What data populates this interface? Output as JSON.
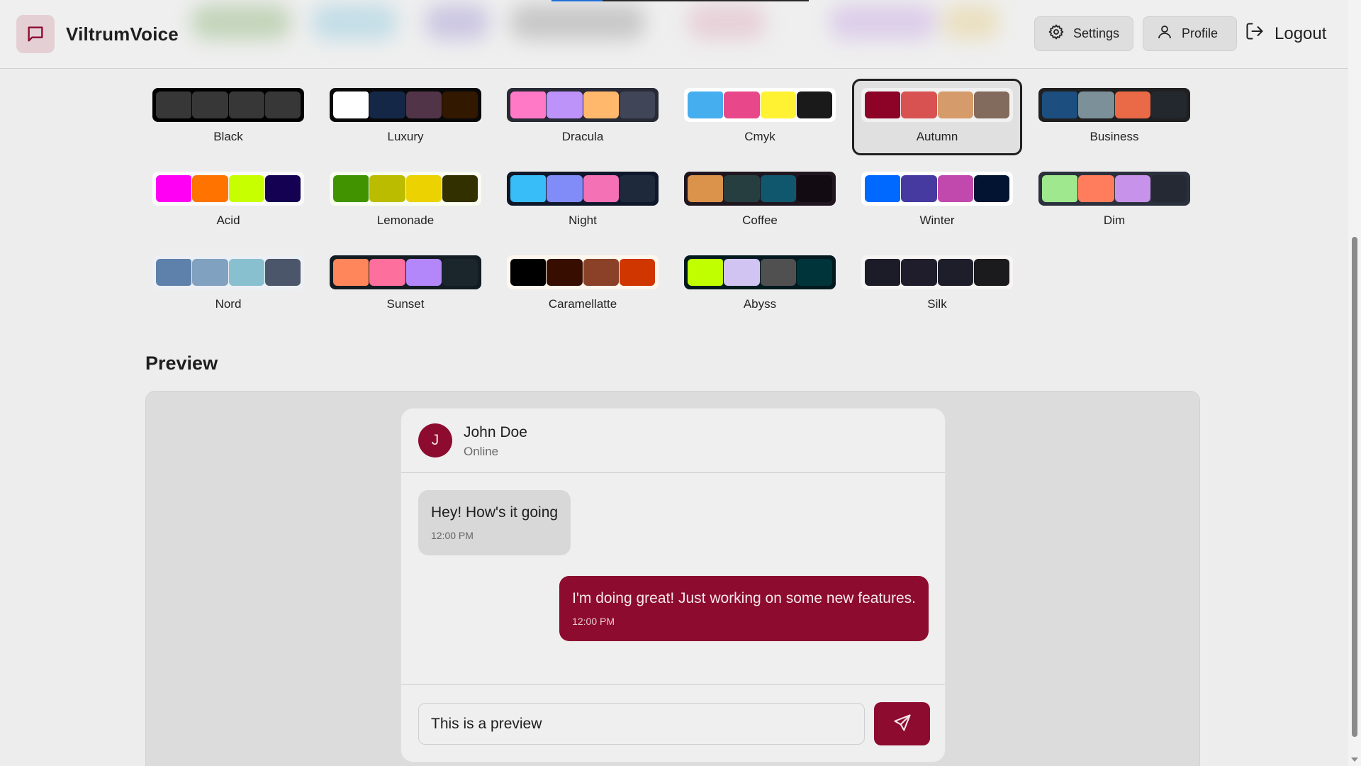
{
  "app": {
    "name": "ViltrumVoice"
  },
  "nav": {
    "settings": "Settings",
    "profile": "Profile",
    "logout": "Logout"
  },
  "themes": [
    {
      "name": "Black",
      "bg": "#000000",
      "colors": [
        "#373737",
        "#373737",
        "#373737",
        "#373737"
      ]
    },
    {
      "name": "Luxury",
      "bg": "#09090b",
      "colors": [
        "#ffffff",
        "#152747",
        "#513448",
        "#331800"
      ]
    },
    {
      "name": "Dracula",
      "bg": "#282a36",
      "colors": [
        "#ff79c6",
        "#bd93f9",
        "#ffb86c",
        "#414558"
      ]
    },
    {
      "name": "Cmyk",
      "bg": "#ffffff",
      "colors": [
        "#45aeee",
        "#e8488a",
        "#fff232",
        "#1a1a1a"
      ]
    },
    {
      "name": "Autumn",
      "bg": "#f1f1f1",
      "colors": [
        "#8c0327",
        "#d85251",
        "#d59b6a",
        "#826a5c"
      ],
      "selected": true
    },
    {
      "name": "Business",
      "bg": "#202020",
      "colors": [
        "#1c4e80",
        "#7c909a",
        "#ea6947",
        "#23282e"
      ]
    },
    {
      "name": "Acid",
      "bg": "#fafafa",
      "colors": [
        "#ff00f4",
        "#ff7400",
        "#c8ff00",
        "#140152"
      ]
    },
    {
      "name": "Lemonade",
      "bg": "#f8fdef",
      "colors": [
        "#419400",
        "#bbbb00",
        "#ebd200",
        "#333000"
      ]
    },
    {
      "name": "Night",
      "bg": "#0f172a",
      "colors": [
        "#38bdf8",
        "#818cf8",
        "#f471b5",
        "#1e293b"
      ]
    },
    {
      "name": "Coffee",
      "bg": "#20161f",
      "colors": [
        "#db924b",
        "#263e3f",
        "#10576d",
        "#120c12"
      ]
    },
    {
      "name": "Winter",
      "bg": "#ffffff",
      "colors": [
        "#0069ff",
        "#463aa1",
        "#c148ac",
        "#021431"
      ]
    },
    {
      "name": "Dim",
      "bg": "#2a303c",
      "colors": [
        "#9fe88d",
        "#ff7d5c",
        "#c792e9",
        "#242933"
      ]
    },
    {
      "name": "Nord",
      "bg": "#eceff4",
      "colors": [
        "#5e81ac",
        "#81a1c1",
        "#88c0d0",
        "#4c566a"
      ]
    },
    {
      "name": "Sunset",
      "bg": "#121c22",
      "colors": [
        "#ff865b",
        "#fd6f9c",
        "#b387fa",
        "#1b262c"
      ]
    },
    {
      "name": "Caramellatte",
      "bg": "#fff7ed",
      "colors": [
        "#000000",
        "#370d00",
        "#8a4128",
        "#cf3600"
      ]
    },
    {
      "name": "Abyss",
      "bg": "#001a1f",
      "colors": [
        "#c0ff00",
        "#d1c4f2",
        "#505050",
        "#00343b"
      ]
    },
    {
      "name": "Silk",
      "bg": "#f7f5f3",
      "colors": [
        "#1c1c29",
        "#1f1d2b",
        "#1d1e2a",
        "#1b1b1d"
      ]
    }
  ],
  "preview": {
    "title": "Preview",
    "contact": {
      "initial": "J",
      "name": "John Doe",
      "status": "Online"
    },
    "messages": [
      {
        "text": "Hey! How's it going",
        "time": "12:00 PM",
        "direction": "incoming"
      },
      {
        "text": "I'm doing great! Just working on some new features.",
        "time": "12:00 PM",
        "direction": "outgoing"
      }
    ],
    "input_value": "This is a preview"
  },
  "colors": {
    "primary": "#8c0b2e",
    "background": "#ededed"
  }
}
